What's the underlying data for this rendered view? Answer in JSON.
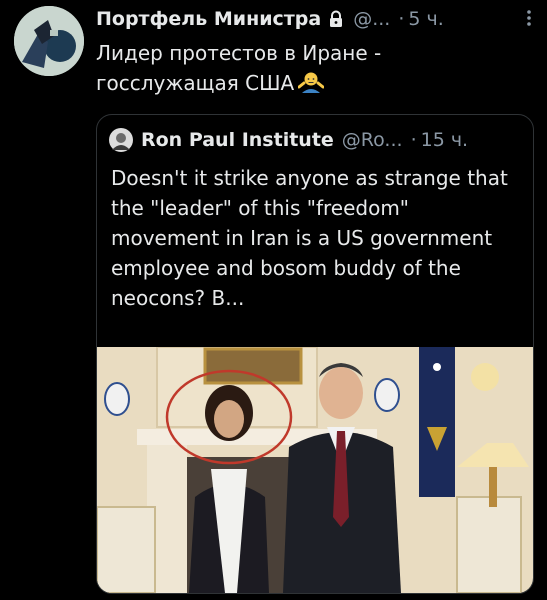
{
  "tweet": {
    "author_name": "Портфель Министра",
    "handle": "@...",
    "separator": "·",
    "time": "5 ч.",
    "text": "Лидер протестов в Иране - госслужащая США",
    "emoji": "person-shrugging"
  },
  "quote": {
    "author_name": "Ron Paul Institute",
    "handle": "@Ro...",
    "separator": "·",
    "time": "15 ч.",
    "text": "Doesn't it strike anyone as strange that the \"leader\" of this \"freedom\" movement in Iran is a US government employee and bosom buddy of the neocons? B..."
  },
  "colors": {
    "background": "#000000",
    "text": "#e7e9ea",
    "secondary": "#8b98a5",
    "border": "#2f3336",
    "highlight_circle": "#c0392b"
  }
}
